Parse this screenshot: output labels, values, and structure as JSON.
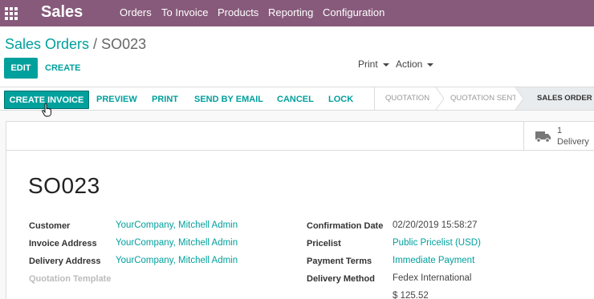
{
  "navbar": {
    "brand": "Sales",
    "menus": [
      "Orders",
      "To Invoice",
      "Products",
      "Reporting",
      "Configuration"
    ]
  },
  "breadcrumb": {
    "parent": "Sales Orders",
    "separator": "/",
    "current": "SO023"
  },
  "control": {
    "edit_label": "EDIT",
    "create_label": "CREATE",
    "print_label": "Print",
    "action_label": "Action"
  },
  "statusbar": {
    "buttons": {
      "create_invoice": "CREATE INVOICE",
      "preview": "PREVIEW",
      "print": "PRINT",
      "send_email": "SEND BY EMAIL",
      "cancel": "CANCEL",
      "lock": "LOCK"
    },
    "stages": [
      "QUOTATION",
      "QUOTATION SENT",
      "SALES ORDER"
    ],
    "active_stage": "SALES ORDER"
  },
  "smart_button": {
    "value": "1",
    "label": "Delivery",
    "icon": "truck-icon"
  },
  "form": {
    "title": "SO023",
    "left": [
      {
        "label": "Customer",
        "value": "YourCompany, Mitchell Admin"
      },
      {
        "label": "Invoice Address",
        "value": "YourCompany, Mitchell Admin"
      },
      {
        "label": "Delivery Address",
        "value": "YourCompany, Mitchell Admin"
      },
      {
        "label": "Quotation Template",
        "value": ""
      }
    ],
    "right": [
      {
        "label": "Confirmation Date",
        "value": "02/20/2019 15:58:27"
      },
      {
        "label": "Pricelist",
        "value": "Public Pricelist (USD)"
      },
      {
        "label": "Payment Terms",
        "value": "Immediate Payment"
      },
      {
        "label": "Delivery Method",
        "value": "Fedex International"
      },
      {
        "label": "",
        "value": "$ 125.52"
      }
    ]
  },
  "colors": {
    "navbar": "#875a7b",
    "accent": "#00a09d"
  }
}
